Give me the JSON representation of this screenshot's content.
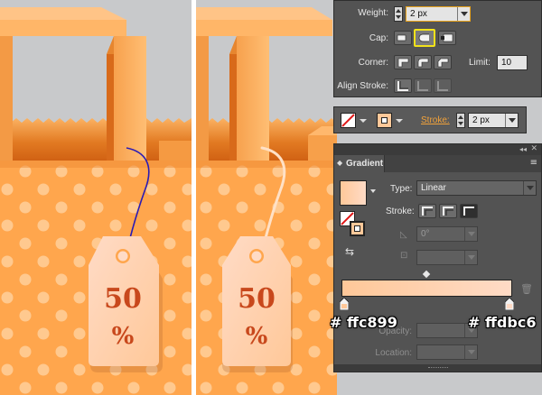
{
  "tags": [
    {
      "big": "50",
      "small": "%"
    },
    {
      "big": "50",
      "small": "%"
    }
  ],
  "stroke_panel": {
    "weight_label": "Weight:",
    "weight_value": "2 px",
    "cap_label": "Cap:",
    "corner_label": "Corner:",
    "limit_label": "Limit:",
    "limit_value": "10",
    "align_label": "Align Stroke:"
  },
  "control_bar": {
    "stroke_label": "Stroke:",
    "stroke_value": "2 px"
  },
  "gradient_panel": {
    "tab_label": "Gradient",
    "type_label": "Type:",
    "type_value": "Linear",
    "stroke_label": "Stroke:",
    "angle_value": "0°",
    "opacity_label": "Opacity:",
    "location_label": "Location:"
  },
  "annotations": {
    "left_color": "# ffc899",
    "right_color": "# ffdbc6"
  },
  "colors": {
    "bag_orange": "#ffa64d",
    "tag_light": "#ffdbc6",
    "tag_mid": "#ffc899",
    "text_red": "#c8481c",
    "panel_bg": "#535353",
    "highlight_yellow": "#f2e21a",
    "path_blue": "#2a1bb5"
  }
}
